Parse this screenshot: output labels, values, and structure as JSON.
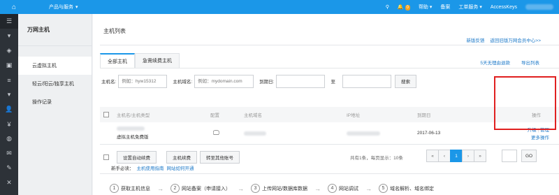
{
  "topbar": {
    "home_icon": "home-icon",
    "menu_label": "产品与服务",
    "notification_count": "0",
    "help_label": "帮助",
    "filing_label": "备案",
    "ticket_label": "工单服务",
    "accesskeys_label": "AccessKeys",
    "colors": {
      "bar": "#1b97e8",
      "badge": "#f7a21b"
    }
  },
  "sidebar": {
    "title": "万网主机",
    "items": [
      {
        "label": "云虚拟主机"
      },
      {
        "label": "轻云/阳云/独享主机"
      },
      {
        "label": "操作记录"
      }
    ]
  },
  "main": {
    "page_title": "主机列表",
    "links": [
      "新版反馈",
      "返回旧版万网会员中心>>"
    ],
    "tabs": [
      "全部主机",
      "急需续费主机"
    ],
    "tab_links": [
      "5天无理由退款",
      "导出列表"
    ],
    "search": {
      "host_name_label": "主机名:",
      "host_name_placeholder": "例如：hyw15312",
      "host_domain_label": "主机域名:",
      "host_domain_placeholder": "例如：mydomain.com",
      "expiry_label": "到期日:",
      "to_label": "至",
      "search_button": "搜索"
    },
    "table": {
      "headers": [
        "主机名/主机类型",
        "配置",
        "主机域名",
        "IP地址",
        "到期日",
        "操作"
      ],
      "rows": [
        {
          "type": "虚拟主机免费版",
          "expiry": "2017-06-13",
          "actions": [
            "升级",
            "管理",
            "更多操作"
          ]
        }
      ]
    },
    "footer": {
      "buttons": [
        "设置自动续费",
        "主机续费",
        "转至其他账号"
      ],
      "summary": "共有1条，每页显示：10条",
      "pager": [
        "«",
        "‹",
        "1",
        "›",
        "»"
      ],
      "go_button": "GO"
    },
    "guide": {
      "prefix": "新手必读：",
      "links": [
        "主机使用指南",
        "网站如何开通"
      ],
      "steps": [
        {
          "num": "1",
          "label": "获取主机信息"
        },
        {
          "num": "2",
          "label": "网站备案（申请接入）"
        },
        {
          "num": "3",
          "label": "上传网站/数据库数据"
        },
        {
          "num": "4",
          "label": "网站调试"
        },
        {
          "num": "5",
          "label": "域名解析、域名绑定"
        }
      ]
    }
  }
}
